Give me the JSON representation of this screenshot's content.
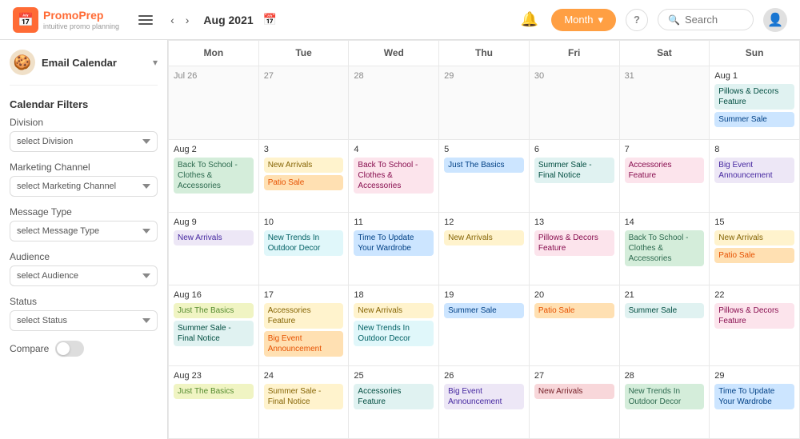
{
  "header": {
    "logo_name": "PromoPrep",
    "logo_tagline": "intuitive promo planning",
    "nav_month": "Aug 2021",
    "month_btn_label": "Month",
    "search_placeholder": "Search",
    "search_label": "Search"
  },
  "sidebar": {
    "avatar_emoji": "🍪",
    "title": "Email Calendar",
    "filters_heading": "Calendar Filters",
    "division_label": "Division",
    "division_placeholder": "select Division",
    "channel_label": "Marketing Channel",
    "channel_placeholder": "select Marketing Channel",
    "msgtype_label": "Message Type",
    "msgtype_placeholder": "select Message Type",
    "audience_label": "Audience",
    "audience_placeholder": "select Audience",
    "status_label": "Status",
    "status_placeholder": "select Status",
    "compare_label": "Compare"
  },
  "calendar": {
    "headers": [
      "Mon",
      "Tue",
      "Wed",
      "Thu",
      "Fri",
      "Sat",
      "Sun"
    ],
    "weeks": [
      [
        {
          "date": "Jul 26",
          "other": true,
          "events": []
        },
        {
          "date": "27",
          "other": true,
          "events": []
        },
        {
          "date": "28",
          "other": true,
          "events": []
        },
        {
          "date": "29",
          "other": true,
          "events": []
        },
        {
          "date": "30",
          "other": true,
          "events": []
        },
        {
          "date": "31",
          "other": true,
          "events": []
        },
        {
          "date": "Aug 1",
          "other": false,
          "events": [
            {
              "label": "Pillows & Decors Feature",
              "color": "teal"
            },
            {
              "label": "Summer Sale",
              "color": "blue"
            }
          ]
        }
      ],
      [
        {
          "date": "Aug 2",
          "other": false,
          "events": [
            {
              "label": "Back To School - Clothes & Accessories",
              "color": "green"
            }
          ]
        },
        {
          "date": "3",
          "other": false,
          "events": [
            {
              "label": "New Arrivals",
              "color": "yellow"
            },
            {
              "label": "Patio Sale",
              "color": "orange"
            }
          ]
        },
        {
          "date": "4",
          "other": false,
          "events": [
            {
              "label": "Back To School - Clothes & Accessories",
              "color": "pink"
            }
          ]
        },
        {
          "date": "5",
          "other": false,
          "events": [
            {
              "label": "Just The Basics",
              "color": "blue"
            }
          ]
        },
        {
          "date": "6",
          "other": false,
          "events": [
            {
              "label": "Summer Sale - Final Notice",
              "color": "teal"
            }
          ]
        },
        {
          "date": "7",
          "other": false,
          "events": [
            {
              "label": "Accessories Feature",
              "color": "pink"
            }
          ]
        },
        {
          "date": "8",
          "other": false,
          "events": [
            {
              "label": "Big Event Announcement",
              "color": "purple"
            }
          ]
        }
      ],
      [
        {
          "date": "Aug 9",
          "other": false,
          "events": [
            {
              "label": "New Arrivals",
              "color": "purple"
            }
          ]
        },
        {
          "date": "10",
          "other": false,
          "events": [
            {
              "label": "New Trends In Outdoor Decor",
              "color": "cyan"
            }
          ]
        },
        {
          "date": "11",
          "other": false,
          "events": [
            {
              "label": "Time To Update Your Wardrobe",
              "color": "blue"
            }
          ]
        },
        {
          "date": "12",
          "other": false,
          "events": [
            {
              "label": "New Arrivals",
              "color": "yellow"
            }
          ]
        },
        {
          "date": "13",
          "other": false,
          "events": [
            {
              "label": "Pillows & Decors Feature",
              "color": "pink"
            }
          ]
        },
        {
          "date": "14",
          "other": false,
          "events": [
            {
              "label": "Back To School - Clothes & Accessories",
              "color": "green"
            }
          ]
        },
        {
          "date": "15",
          "other": false,
          "events": [
            {
              "label": "New Arrivals",
              "color": "yellow"
            },
            {
              "label": "Patio Sale",
              "color": "orange"
            }
          ]
        }
      ],
      [
        {
          "date": "Aug 16",
          "other": false,
          "events": [
            {
              "label": "Just The Basics",
              "color": "lime"
            },
            {
              "label": "Summer Sale - Final Notice",
              "color": "teal"
            }
          ]
        },
        {
          "date": "17",
          "other": false,
          "events": [
            {
              "label": "Accessories Feature",
              "color": "yellow"
            },
            {
              "label": "Big Event Announcement",
              "color": "orange"
            }
          ]
        },
        {
          "date": "18",
          "other": false,
          "events": [
            {
              "label": "New Arrivals",
              "color": "yellow"
            },
            {
              "label": "New Trends In Outdoor Decor",
              "color": "cyan"
            }
          ]
        },
        {
          "date": "19",
          "other": false,
          "events": [
            {
              "label": "Summer Sale",
              "color": "blue"
            }
          ]
        },
        {
          "date": "20",
          "other": false,
          "events": [
            {
              "label": "Patio Sale",
              "color": "orange"
            }
          ]
        },
        {
          "date": "21",
          "other": false,
          "events": [
            {
              "label": "Summer Sale",
              "color": "teal"
            }
          ]
        },
        {
          "date": "22",
          "other": false,
          "events": [
            {
              "label": "Pillows & Decors Feature",
              "color": "pink"
            }
          ]
        }
      ],
      [
        {
          "date": "Aug 23",
          "other": false,
          "events": [
            {
              "label": "Just The Basics",
              "color": "lime"
            }
          ]
        },
        {
          "date": "24",
          "other": false,
          "events": [
            {
              "label": "Summer Sale - Final Notice",
              "color": "yellow"
            }
          ]
        },
        {
          "date": "25",
          "other": false,
          "events": [
            {
              "label": "Accessories Feature",
              "color": "teal"
            }
          ]
        },
        {
          "date": "26",
          "other": false,
          "events": [
            {
              "label": "Big Event Announcement",
              "color": "purple"
            }
          ]
        },
        {
          "date": "27",
          "other": false,
          "events": [
            {
              "label": "New Arrivals",
              "color": "red"
            }
          ]
        },
        {
          "date": "28",
          "other": false,
          "events": [
            {
              "label": "New Trends In Outdoor Decor",
              "color": "green"
            }
          ]
        },
        {
          "date": "29",
          "other": false,
          "events": [
            {
              "label": "Time To Update Your Wardrobe",
              "color": "blue"
            }
          ]
        }
      ]
    ]
  },
  "colors": {
    "accent": "#ff9f43",
    "brand": "#ff6b35"
  }
}
